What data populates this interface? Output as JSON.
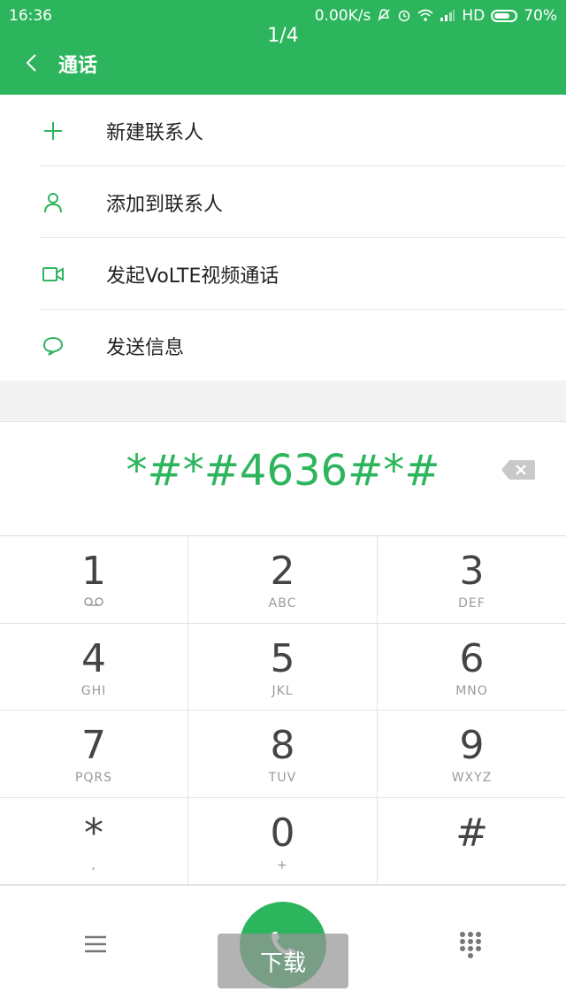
{
  "status_bar": {
    "time": "16:36",
    "network_speed": "0.00K/s",
    "network_type": "HD",
    "battery": "70%"
  },
  "page_indicator": "1/4",
  "header": {
    "title": "通话"
  },
  "menu": {
    "items": [
      {
        "label": "新建联系人",
        "icon": "plus-icon"
      },
      {
        "label": "添加到联系人",
        "icon": "person-icon"
      },
      {
        "label": "发起VoLTE视频通话",
        "icon": "video-icon"
      },
      {
        "label": "发送信息",
        "icon": "message-icon"
      }
    ]
  },
  "dialer": {
    "number": "*#*#4636#*#"
  },
  "keypad": {
    "keys": [
      {
        "digit": "1",
        "letters": ""
      },
      {
        "digit": "2",
        "letters": "ABC"
      },
      {
        "digit": "3",
        "letters": "DEF"
      },
      {
        "digit": "4",
        "letters": "GHI"
      },
      {
        "digit": "5",
        "letters": "JKL"
      },
      {
        "digit": "6",
        "letters": "MNO"
      },
      {
        "digit": "7",
        "letters": "PQRS"
      },
      {
        "digit": "8",
        "letters": "TUV"
      },
      {
        "digit": "9",
        "letters": "WXYZ"
      },
      {
        "digit": "*",
        "letters": ","
      },
      {
        "digit": "0",
        "letters": "+"
      },
      {
        "digit": "#",
        "letters": ""
      }
    ]
  },
  "bottom_bar": {
    "overlay_label": "下载"
  },
  "colors": {
    "accent": "#2db55d",
    "text": "#222222",
    "muted": "#9a9a9a"
  }
}
